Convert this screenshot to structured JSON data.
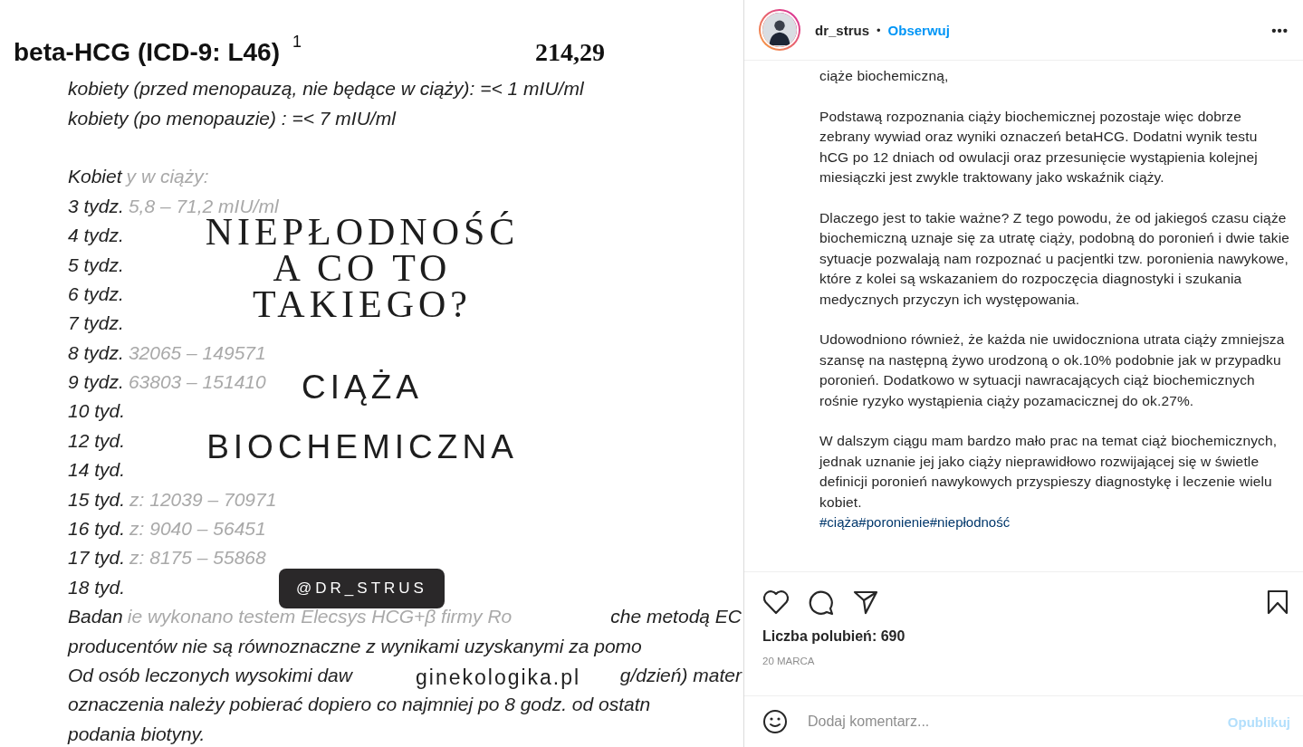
{
  "post_image": {
    "document": {
      "title": "beta-HCG (ICD-9: L46)",
      "superscript": "1",
      "value": "214,29",
      "lines": [
        {
          "text": "kobiety (przed menopauzą, nie będące w ciąży): =< 1 mIU/ml"
        },
        {
          "text": "kobiety (po menopauzie) : =< 7 mIU/ml"
        },
        {
          "text": "Kobiet",
          "faded": "y w ciąży:",
          "gap_before": true
        },
        {
          "text": "3 tydz.",
          "faded": "5,8 – 71,2 mIU/ml"
        },
        {
          "text": "4 tydz."
        },
        {
          "text": "5 tydz."
        },
        {
          "text": "6 tydz."
        },
        {
          "text": "7 tydz."
        },
        {
          "text": "8 tydz.",
          "faded": "32065 – 149571"
        },
        {
          "text": "9 tydz.",
          "faded": "63803 – 151410"
        },
        {
          "text": "10 tyd."
        },
        {
          "text": "12 tyd."
        },
        {
          "text": "14 tyd."
        },
        {
          "text": "15 tyd.",
          "faded": "z: 12039 – 70971"
        },
        {
          "text": "16 tyd.",
          "faded": "z: 9040 – 56451"
        },
        {
          "text": "17 tyd.",
          "faded": "z: 8175 – 55868"
        },
        {
          "text": "18 tyd."
        },
        {
          "text": "Badan",
          "faded": "ie wykonano testem Elecsys HCG+β firmy Ro",
          "tail": "che metodą EC"
        },
        {
          "text": "producentów nie są równoznaczne z wynikami uzyskanymi za pomo"
        },
        {
          "text": "Od osób leczonych wysokimi daw",
          "tail": "g/dzień) mater"
        },
        {
          "text": "oznaczenia należy pobierać dopiero co najmniej po 8 godz. od ostatn"
        },
        {
          "text": "podania biotyny."
        }
      ]
    },
    "overlay": {
      "title_lines": [
        "NIEPŁODNOŚĆ",
        "A CO TO",
        "TAKIEGO?"
      ],
      "subtitle_lines": [
        "CIĄŻA",
        "BIOCHEMICZNA"
      ],
      "handle": "@DR_STRUS",
      "site": "ginekologika.pl"
    }
  },
  "header": {
    "username": "dr_strus",
    "separator": "•",
    "follow": "Obserwuj",
    "more": "•••"
  },
  "caption": {
    "paragraphs": [
      "ciąże biochemiczną,",
      "Podstawą rozpoznania ciąży biochemicznej pozostaje więc dobrze zebrany wywiad oraz wyniki oznaczeń betaHCG. Dodatni wynik testu hCG po 12 dniach od owulacji oraz przesunięcie wystąpienia kolejnej miesiączki jest zwykle traktowany jako wskaźnik ciąży.",
      "Dlaczego jest to takie ważne? Z tego powodu, że od jakiegoś czasu ciąże biochemiczną uznaje się za utratę ciąży, podobną do poronień i dwie takie sytuacje pozwalają nam rozpoznać u pacjentki tzw. poronienia nawykowe, które z kolei są wskazaniem do rozpoczęcia diagnostyki i szukania medycznych przyczyn ich występowania.",
      "Udowodniono również, że każda nie uwidoczniona utrata ciąży zmniejsza szansę na następną żywo urodzoną o ok.10% podobnie jak w przypadku poronień. Dodatkowo w sytuacji nawracających ciąż biochemicznych rośnie ryzyko wystąpienia ciąży pozamacicznej do ok.27%.",
      "W dalszym ciągu mam bardzo mało prac na temat ciąż biochemicznych, jednak uznanie jej jako ciąży nieprawidłowo rozwijającej się w świetle definicji poronień nawykowych przyspieszy diagnostykę i leczenie wielu kobiet."
    ],
    "hashtags": [
      "#ciąża",
      "#poronienie",
      "#niepłodność"
    ]
  },
  "likes": "Liczba polubień: 690",
  "date": "20 MARCA",
  "comment": {
    "placeholder": "Dodaj komentarz...",
    "submit": "Opublikuj",
    "submit_disabled": true
  }
}
